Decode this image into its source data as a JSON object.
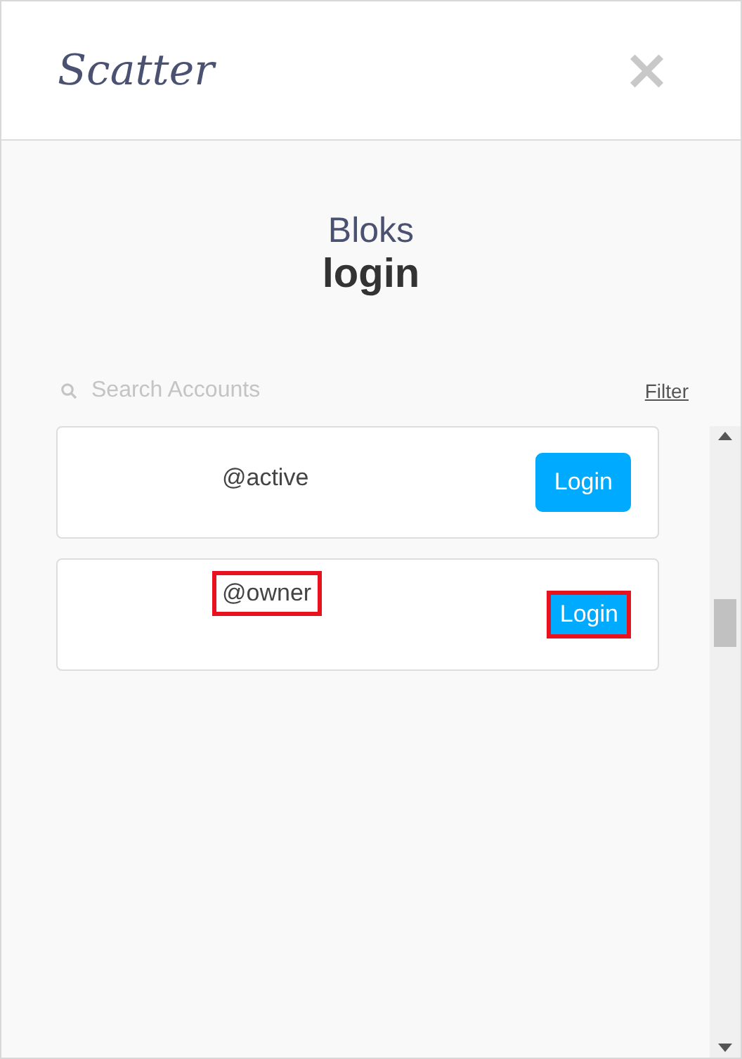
{
  "header": {
    "logo": "Scatter",
    "close": "×"
  },
  "title": {
    "app": "Bloks",
    "action": "login"
  },
  "search": {
    "placeholder": "Search Accounts",
    "filter": "Filter"
  },
  "accounts": [
    {
      "name": "@active",
      "button": "Login",
      "highlighted": false
    },
    {
      "name": "@owner",
      "button": "Login",
      "highlighted": true
    }
  ]
}
